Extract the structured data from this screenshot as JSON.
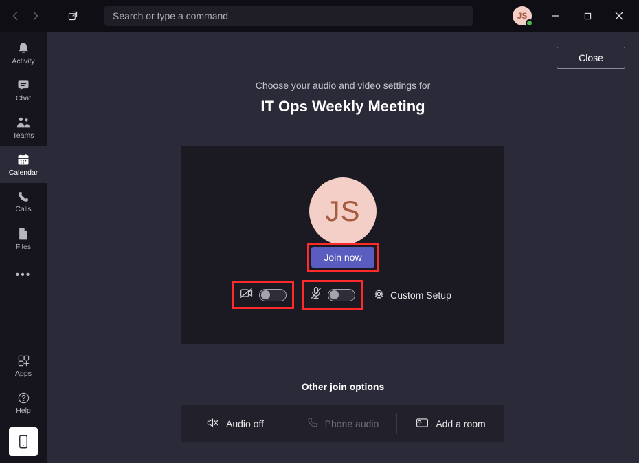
{
  "titlebar": {
    "search_placeholder": "Search or type a command",
    "avatar_initials": "JS"
  },
  "sidebar": {
    "items": [
      {
        "label": "Activity"
      },
      {
        "label": "Chat"
      },
      {
        "label": "Teams"
      },
      {
        "label": "Calendar"
      },
      {
        "label": "Calls"
      },
      {
        "label": "Files"
      }
    ],
    "apps_label": "Apps",
    "help_label": "Help"
  },
  "main": {
    "close_label": "Close",
    "preamble": "Choose your audio and video settings for",
    "meeting_title": "IT Ops Weekly Meeting",
    "avatar_initials": "JS",
    "join_label": "Join now",
    "custom_setup_label": "Custom Setup",
    "other_options_label": "Other join options",
    "options": {
      "audio_off": "Audio off",
      "phone_audio": "Phone audio",
      "add_room": "Add a room"
    }
  }
}
